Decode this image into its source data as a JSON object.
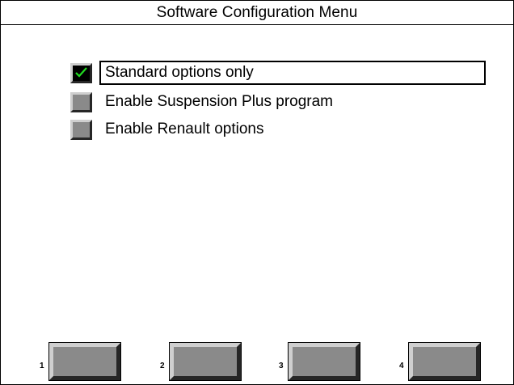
{
  "window": {
    "title": "Software Configuration Menu"
  },
  "options": [
    {
      "label": "Standard options only",
      "checked": true,
      "selected": true
    },
    {
      "label": "Enable Suspension Plus program",
      "checked": false,
      "selected": false
    },
    {
      "label": "Enable Renault options",
      "checked": false,
      "selected": false
    }
  ],
  "function_keys": [
    {
      "number": "1",
      "label": ""
    },
    {
      "number": "2",
      "label": ""
    },
    {
      "number": "3",
      "label": ""
    },
    {
      "number": "4",
      "label": ""
    }
  ],
  "colors": {
    "checkmark": "#22dd22",
    "button_face": "#8a8a8a",
    "bevel_light": "#cfcfcf",
    "bevel_dark": "#262626"
  }
}
